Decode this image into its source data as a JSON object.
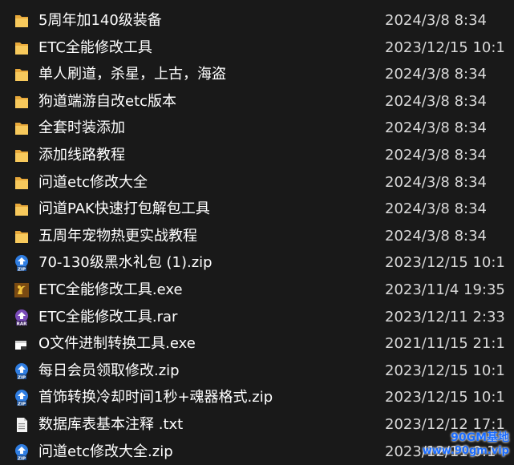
{
  "files": [
    {
      "name": "5周年加140级装备",
      "date": "2024/3/8 8:34",
      "icon": "folder-icon"
    },
    {
      "name": "ETC全能修改工具",
      "date": "2023/12/15 10:1",
      "icon": "folder-icon"
    },
    {
      "name": "单人刷道，杀星，上古，海盗",
      "date": "2024/3/8 8:34",
      "icon": "folder-icon"
    },
    {
      "name": "狗道端游自改etc版本",
      "date": "2024/3/8 8:34",
      "icon": "folder-icon"
    },
    {
      "name": "全套时装添加",
      "date": "2024/3/8 8:34",
      "icon": "folder-icon"
    },
    {
      "name": "添加线路教程",
      "date": "2024/3/8 8:34",
      "icon": "folder-icon"
    },
    {
      "name": "问道etc修改大全",
      "date": "2024/3/8 8:34",
      "icon": "folder-icon"
    },
    {
      "name": "问道PAK快速打包解包工具",
      "date": "2024/3/8 8:34",
      "icon": "folder-icon"
    },
    {
      "name": "五周年宠物热更实战教程",
      "date": "2024/3/8 8:34",
      "icon": "folder-icon"
    },
    {
      "name": "70-130级黑水礼包 (1).zip",
      "date": "2023/12/15 10:1",
      "icon": "zip-icon"
    },
    {
      "name": "ETC全能修改工具.exe",
      "date": "2023/11/4 19:35",
      "icon": "app-exe-icon"
    },
    {
      "name": "ETC全能修改工具.rar",
      "date": "2023/12/11 2:33",
      "icon": "rar-icon"
    },
    {
      "name": "O文件进制转换工具.exe",
      "date": "2021/11/15 21:1",
      "icon": "exe-window-icon"
    },
    {
      "name": "每日会员领取修改.zip",
      "date": "2023/12/15 10:1",
      "icon": "zip-icon"
    },
    {
      "name": "首饰转换冷却时间1秒+魂器格式.zip",
      "date": "2023/12/15 10:1",
      "icon": "zip-icon"
    },
    {
      "name": "数据库表基本注释 .txt",
      "date": "2023/12/12 17:1",
      "icon": "text-file-icon"
    },
    {
      "name": "问道etc修改大全.zip",
      "date": "2023/12/11 0:1",
      "icon": "zip-icon"
    }
  ],
  "watermark": {
    "line1": "90GM基地",
    "line2": "www.90gm.vip"
  }
}
